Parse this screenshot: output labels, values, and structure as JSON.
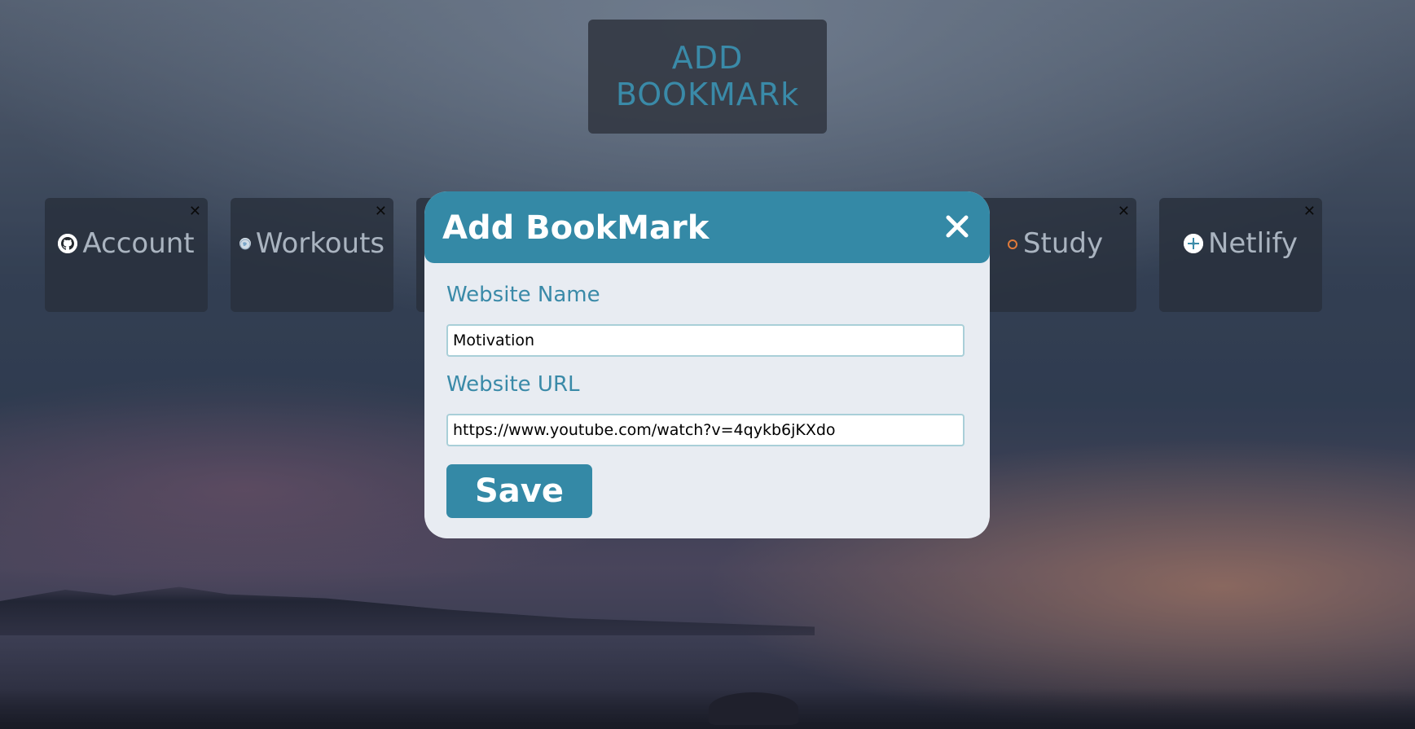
{
  "top_button": {
    "label": "ADD\nBOOKMARk"
  },
  "bookmarks": [
    {
      "label": "Account",
      "icon": "github-icon",
      "close": "✕"
    },
    {
      "label": "Workouts",
      "icon": "globe-icon",
      "close": "✕"
    },
    {
      "label": "Study",
      "icon": "ring-icon",
      "close": "✕"
    },
    {
      "label": "Netlify",
      "icon": "netlify-icon",
      "close": "✕"
    }
  ],
  "modal": {
    "title": "Add BookMark",
    "close_icon": "close-icon",
    "name_label": "Website Name",
    "name_value": "Motivation",
    "url_label": "Website URL",
    "url_value": "https://www.youtube.com/watch?v=4qykb6jKXdo",
    "save_label": "Save"
  },
  "colors": {
    "accent": "#3489a6",
    "modal_bg": "#e8ecf2",
    "card_bg": "#28303c"
  }
}
